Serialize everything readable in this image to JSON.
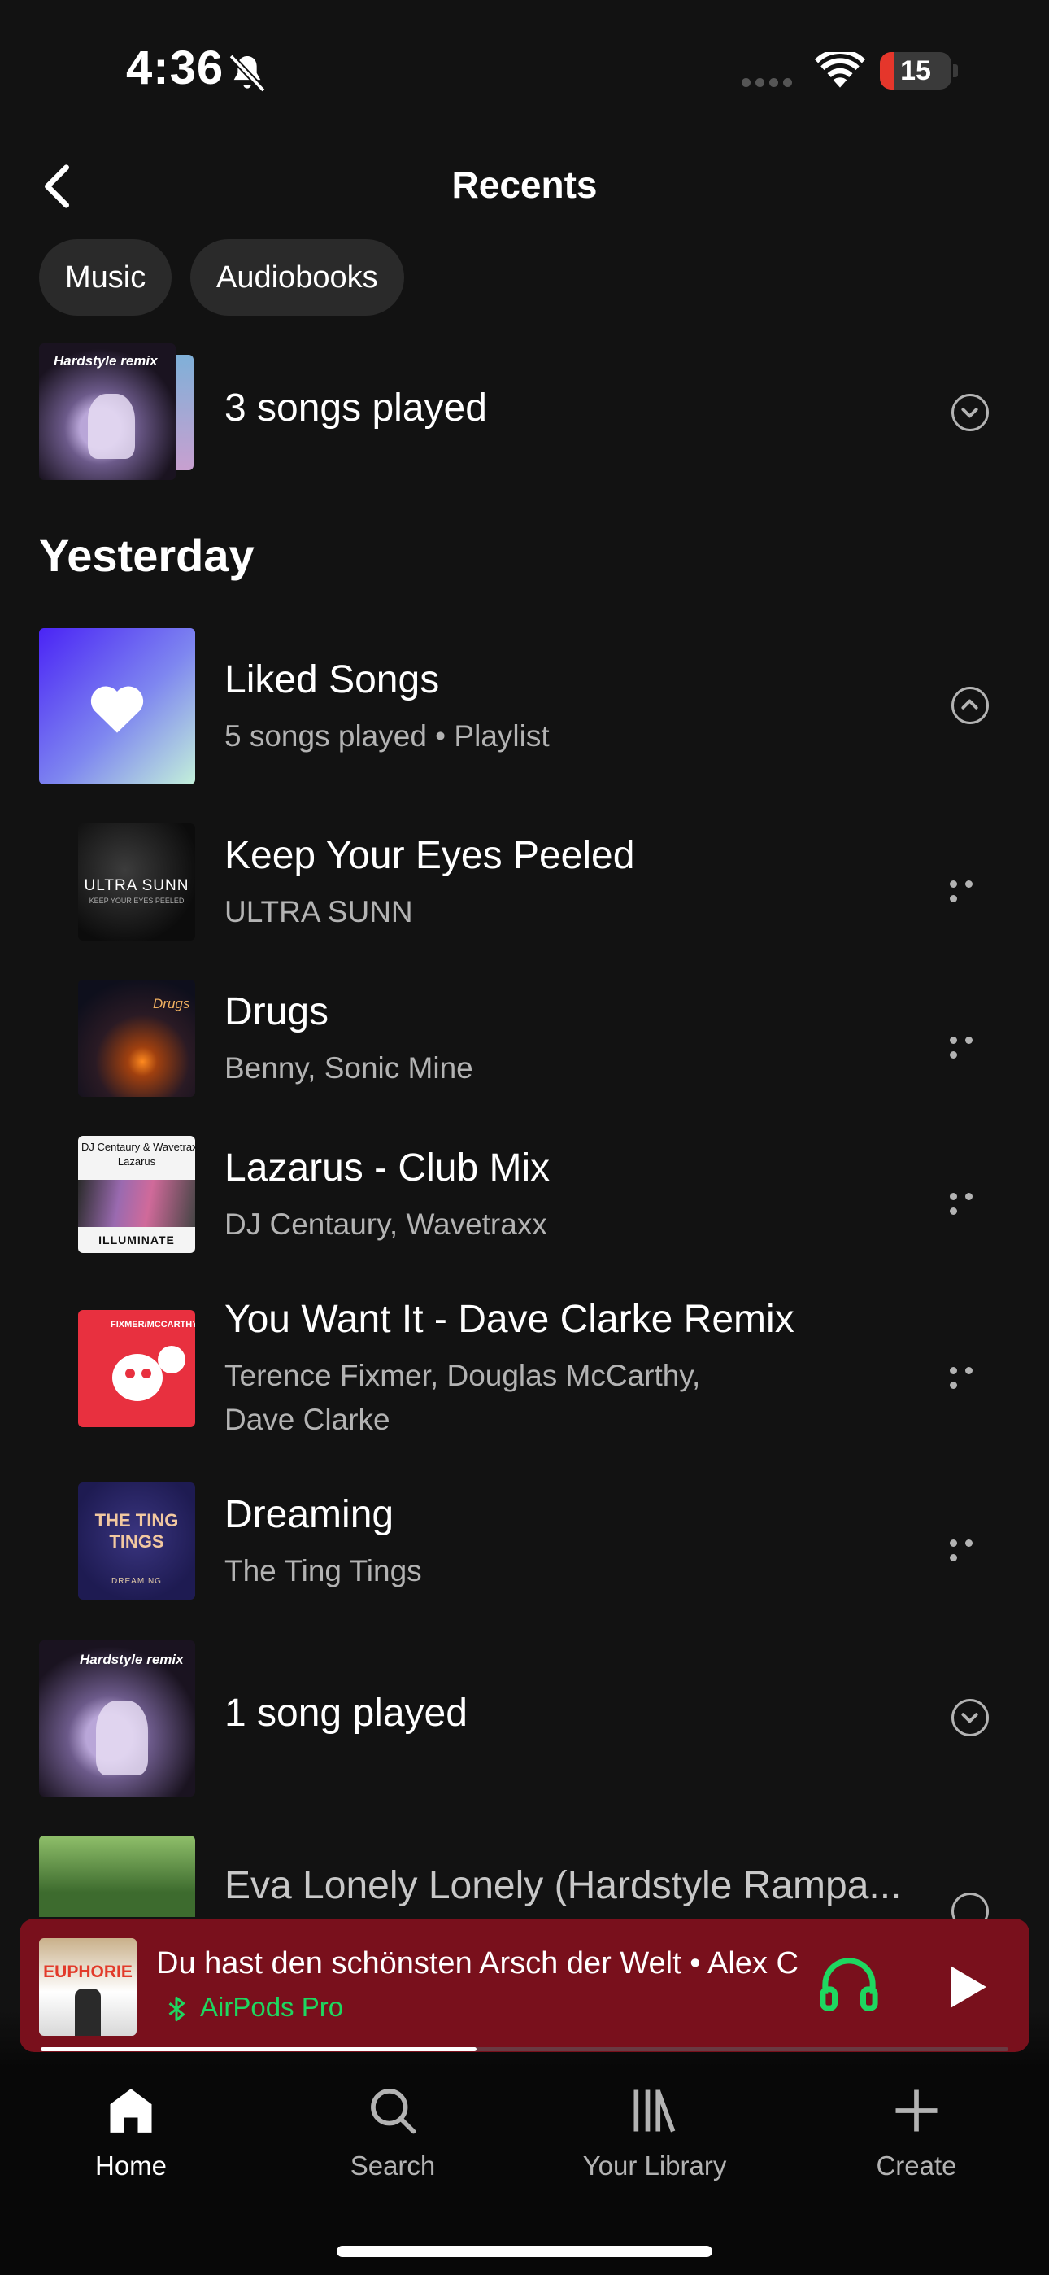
{
  "status_bar": {
    "time": "4:36",
    "battery": "15"
  },
  "header": {
    "title": "Recents"
  },
  "filters": [
    {
      "label": "Music"
    },
    {
      "label": "Audiobooks"
    }
  ],
  "groups": {
    "top": {
      "label": "3 songs played"
    },
    "bottom": {
      "label": "1 song played"
    }
  },
  "section": {
    "title": "Yesterday"
  },
  "liked": {
    "title": "Liked Songs",
    "subtitle": "5 songs played • Playlist"
  },
  "tracks": [
    {
      "title": "Keep Your Eyes Peeled",
      "artist": "ULTRA SUNN"
    },
    {
      "title": "Drugs",
      "artist": "Benny, Sonic Mine"
    },
    {
      "title": "Lazarus - Club Mix",
      "artist": "DJ Centaury, Wavetraxx"
    },
    {
      "title": "You Want It - Dave Clarke Remix",
      "artist_line1": "Terence Fixmer, Douglas McCarthy,",
      "artist_line2": "Dave Clarke"
    },
    {
      "title": "Dreaming",
      "artist": "The Ting Tings"
    }
  ],
  "cover_text": {
    "hardstyle": "Hardstyle remix",
    "ultra_sunn": "ULTRA SUNN",
    "ultra_sunn_sub": "KEEP YOUR EYES PEELED",
    "drugs": "Drugs",
    "lazarus_artists": "DJ Centaury & Wavetraxx",
    "lazarus_title": "Lazarus",
    "illuminate": "ILLUMINATE",
    "fixmer": "FIXMER/MCCARTHY",
    "tingtings": "THE TING TINGS",
    "dreaming": "DREAMING",
    "euphorie": "EUPHORIE"
  },
  "partial_item": {
    "title": "Eva Lonely Lonely (Hardstyle Rampa..."
  },
  "player": {
    "title": "Du hast den schönsten Arsch der Welt • Alex C",
    "device": "AirPods Pro",
    "progress": 0.45
  },
  "nav": [
    {
      "label": "Home",
      "icon": "home-icon"
    },
    {
      "label": "Search",
      "icon": "search-icon"
    },
    {
      "label": "Your Library",
      "icon": "library-icon"
    },
    {
      "label": "Create",
      "icon": "plus-icon"
    }
  ],
  "colors": {
    "accent": "#1ed760",
    "player_bg": "#79101c",
    "background": "#121212"
  }
}
